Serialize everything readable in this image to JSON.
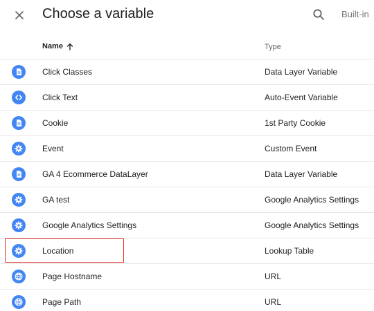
{
  "header": {
    "title": "Choose a variable",
    "builtin_label": "Built-in"
  },
  "columns": {
    "name": "Name",
    "type": "Type",
    "sort": "ascending"
  },
  "rows": [
    {
      "icon": "document-icon",
      "name": "Click Classes",
      "type": "Data Layer Variable"
    },
    {
      "icon": "code-icon",
      "name": "Click Text",
      "type": "Auto-Event Variable"
    },
    {
      "icon": "document-icon",
      "name": "Cookie",
      "type": "1st Party Cookie"
    },
    {
      "icon": "gear-icon",
      "name": "Event",
      "type": "Custom Event"
    },
    {
      "icon": "document-icon",
      "name": "GA 4 Ecommerce DataLayer",
      "type": "Data Layer Variable"
    },
    {
      "icon": "gear-icon",
      "name": "GA test",
      "type": "Google Analytics Settings"
    },
    {
      "icon": "gear-icon",
      "name": "Google Analytics Settings",
      "type": "Google Analytics Settings"
    },
    {
      "icon": "gear-icon",
      "name": "Location",
      "type": "Lookup Table",
      "highlighted": true
    },
    {
      "icon": "globe-icon",
      "name": "Page Hostname",
      "type": "URL"
    },
    {
      "icon": "globe-icon",
      "name": "Page Path",
      "type": "URL"
    }
  ],
  "colors": {
    "icon_bg": "#4285f4",
    "highlight_border": "#e53935"
  }
}
